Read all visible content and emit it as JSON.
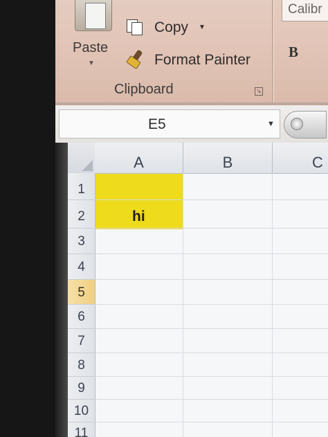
{
  "ribbon": {
    "clipboard": {
      "paste_label": "Paste",
      "copy_label": "Copy",
      "format_painter_label": "Format Painter",
      "group_label": "Clipboard"
    },
    "font": {
      "font_name": "Calibr",
      "bold_label": "B"
    },
    "icons": [
      "paste-icon",
      "copy-icon",
      "format-painter-icon",
      "dialog-launcher-icon"
    ]
  },
  "formula_bar": {
    "name_box_value": "E5"
  },
  "sheet": {
    "columns": [
      "A",
      "B",
      "C"
    ],
    "rows": [
      "1",
      "2",
      "3",
      "4",
      "5",
      "6",
      "7",
      "8",
      "9",
      "10",
      "11"
    ],
    "active_row": "5",
    "cells": {
      "A2": "hi"
    },
    "highlight_color": "#eedb1c"
  }
}
